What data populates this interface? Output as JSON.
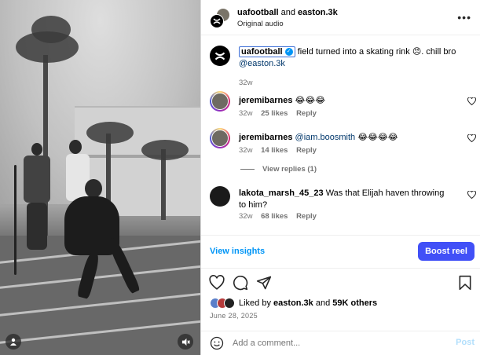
{
  "header": {
    "owner": "uafootball",
    "connector": "and",
    "collaborator": "easton.3k",
    "audio": "Original audio",
    "more_icon": "more-horizontal-icon"
  },
  "caption": {
    "username": "uafootball",
    "text": "field turned into a skating rink 😠. chill bro",
    "mention": "@easton.3k",
    "time": "32w"
  },
  "comments": [
    {
      "username": "jeremibarnes",
      "mention": "",
      "text": "😂😂😂",
      "time": "32w",
      "likes": "25 likes",
      "reply": "Reply"
    },
    {
      "username": "jeremibarnes",
      "mention": "@iam.boosmith",
      "text": "😂😂😂😂",
      "time": "32w",
      "likes": "14 likes",
      "reply": "Reply"
    },
    {
      "username": "lakota_marsh_45_23",
      "mention": "",
      "text": "Was that Elijah haven throwing to him?",
      "time": "32w",
      "likes": "68 likes",
      "reply": "Reply"
    }
  ],
  "view_replies": "View replies (1)",
  "insights": {
    "view_label": "View insights",
    "boost_label": "Boost reel"
  },
  "likes": {
    "prefix": "Liked by",
    "user": "easton.3k",
    "and": "and",
    "count": "59K others"
  },
  "date": "June 28, 2025",
  "add_comment": {
    "placeholder": "Add a comment...",
    "post_label": "Post"
  },
  "colors": {
    "accent": "#0095f6",
    "boost": "#4150f7",
    "post_disabled": "#b2dffc"
  }
}
